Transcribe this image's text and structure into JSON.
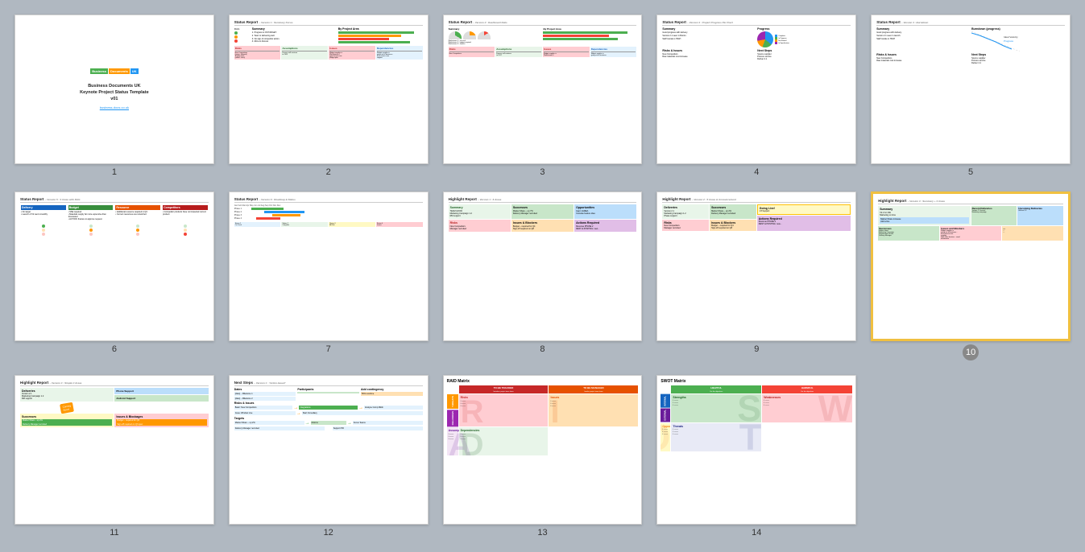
{
  "slides": [
    {
      "id": 1,
      "number": "1",
      "type": "title",
      "title": "Business Documents UK\nKeynote Project Status Template\nv01",
      "link": "business-docs.co.uk",
      "logo": [
        "Business",
        "Documents",
        "UK"
      ]
    },
    {
      "id": 2,
      "number": "2",
      "type": "status-report",
      "title": "Status Report",
      "subtitle": "– Version 1 : Summary Focus"
    },
    {
      "id": 3,
      "number": "3",
      "type": "status-dashboard",
      "title": "Status Report",
      "subtitle": "– Version 2 : Dashboard Dials"
    },
    {
      "id": 4,
      "number": "4",
      "type": "status-pie",
      "title": "Status Report",
      "subtitle": "– Version 3 : Project Progress Pie Chart"
    },
    {
      "id": 5,
      "number": "5",
      "type": "status-burndown",
      "title": "Status Report",
      "subtitle": "– Version 4 : Burndown"
    },
    {
      "id": 6,
      "number": "6",
      "type": "status-rag",
      "title": "Status Report",
      "subtitle": "– Version 5 : 4 Areas with RAG"
    },
    {
      "id": 7,
      "number": "7",
      "type": "status-roadmap",
      "title": "Status Report",
      "subtitle": "– Version 6 : Roadmap & Status"
    },
    {
      "id": 8,
      "number": "8",
      "type": "highlight-6areas",
      "title": "Highlight Report",
      "subtitle": "– Version 1 : 6 Areas"
    },
    {
      "id": 9,
      "number": "9",
      "type": "highlight-5areas",
      "title": "Highlight Report",
      "subtitle": "– Version 2 : 5 Areas & Announcement"
    },
    {
      "id": 10,
      "number": "10",
      "type": "highlight-summary",
      "title": "Highlight Report",
      "subtitle": "– Version 3 : Summary + 4 Areas",
      "active": true
    },
    {
      "id": 11,
      "number": "11",
      "type": "highlight-4areas",
      "title": "Highlight Report",
      "subtitle": "– Version 4 : Simple 4 Areas"
    },
    {
      "id": 12,
      "number": "12",
      "type": "next-steps",
      "title": "Next Steps",
      "subtitle": "– Version 1 : 'Action-based'"
    },
    {
      "id": 13,
      "number": "13",
      "type": "raid-matrix",
      "title": "RAID Matrix",
      "subtitle": ""
    },
    {
      "id": 14,
      "number": "14",
      "type": "swot-matrix",
      "title": "SWOT Matrix",
      "subtitle": ""
    }
  ]
}
